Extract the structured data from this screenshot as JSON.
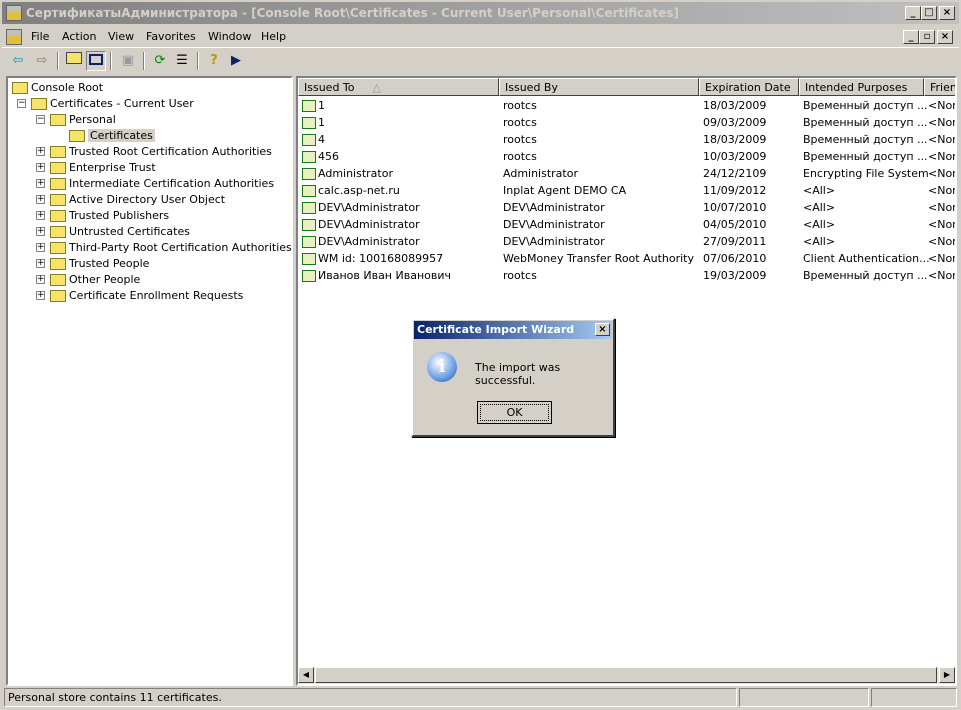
{
  "window": {
    "title": "СертификатыАдминистратора - [Console Root\\Certificates - Current User\\Personal\\Certificates]"
  },
  "menu": [
    "File",
    "Action",
    "View",
    "Favorites",
    "Window",
    "Help"
  ],
  "tree": [
    {
      "label": "Console Root",
      "level": 0,
      "expander": ""
    },
    {
      "label": "Certificates - Current User",
      "level": 1,
      "expander": "-"
    },
    {
      "label": "Personal",
      "level": 2,
      "expander": "-"
    },
    {
      "label": "Certificates",
      "level": 3,
      "expander": "",
      "selected": true
    },
    {
      "label": "Trusted Root Certification Authorities",
      "level": 2,
      "expander": "+"
    },
    {
      "label": "Enterprise Trust",
      "level": 2,
      "expander": "+"
    },
    {
      "label": "Intermediate Certification Authorities",
      "level": 2,
      "expander": "+"
    },
    {
      "label": "Active Directory User Object",
      "level": 2,
      "expander": "+"
    },
    {
      "label": "Trusted Publishers",
      "level": 2,
      "expander": "+"
    },
    {
      "label": "Untrusted Certificates",
      "level": 2,
      "expander": "+"
    },
    {
      "label": "Third-Party Root Certification Authorities",
      "level": 2,
      "expander": "+"
    },
    {
      "label": "Trusted People",
      "level": 2,
      "expander": "+"
    },
    {
      "label": "Other People",
      "level": 2,
      "expander": "+"
    },
    {
      "label": "Certificate Enrollment Requests",
      "level": 2,
      "expander": "+"
    }
  ],
  "columns": [
    "Issued To",
    "Issued By",
    "Expiration Date",
    "Intended Purposes",
    "Friendly Name"
  ],
  "rows": [
    [
      "1",
      "rootcs",
      "18/03/2009",
      "Временный доступ ...",
      "<None>"
    ],
    [
      "1",
      "rootcs",
      "09/03/2009",
      "Временный доступ ...",
      "<None>"
    ],
    [
      "4",
      "rootcs",
      "18/03/2009",
      "Временный доступ ...",
      "<None>"
    ],
    [
      "456",
      "rootcs",
      "10/03/2009",
      "Временный доступ ...",
      "<None>"
    ],
    [
      "Administrator",
      "Administrator",
      "24/12/2109",
      "Encrypting File System",
      "<None>"
    ],
    [
      "calc.asp-net.ru",
      "Inplat Agent DEMO CA",
      "11/09/2012",
      "<All>",
      "<None>"
    ],
    [
      "DEV\\Administrator",
      "DEV\\Administrator",
      "10/07/2010",
      "<All>",
      "<None>"
    ],
    [
      "DEV\\Administrator",
      "DEV\\Administrator",
      "04/05/2010",
      "<All>",
      "<None>"
    ],
    [
      "DEV\\Administrator",
      "DEV\\Administrator",
      "27/09/2011",
      "<All>",
      "<None>"
    ],
    [
      "WM id: 100168089957",
      "WebMoney Transfer Root Authority",
      "07/06/2010",
      "Client Authentication...",
      "<None>"
    ],
    [
      "Иванов Иван Иванович",
      "rootcs",
      "19/03/2009",
      "Временный доступ ...",
      "<None>"
    ]
  ],
  "status": {
    "text": "Personal store contains 11 certificates."
  },
  "dialog": {
    "title": "Certificate Import Wizard",
    "message": "The import was successful.",
    "ok": "OK"
  }
}
